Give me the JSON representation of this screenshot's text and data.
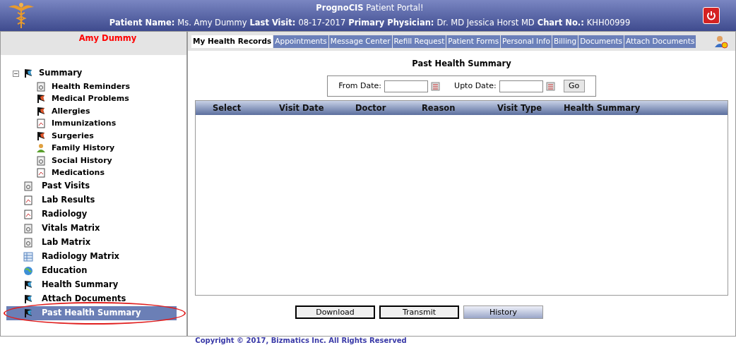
{
  "header": {
    "title": "**PrognoCIS** Patient Portal!",
    "fields": [
      {
        "label": "Patient Name:",
        "value": "Ms. Amy Dummy"
      },
      {
        "label": "Last Visit:",
        "value": "08-17-2017"
      },
      {
        "label": "Primary Physician:",
        "value": "Dr. MD Jessica Horst MD"
      },
      {
        "label": "Chart No.:",
        "value": "KHH00999"
      }
    ]
  },
  "sidebar": {
    "patient_name": "Amy Dummy",
    "items": [
      {
        "label": "Summary",
        "selected": false,
        "expanded": true,
        "children": [
          {
            "label": "Health Reminders",
            "selected": false
          },
          {
            "label": "Medical Problems",
            "selected": false
          },
          {
            "label": "Allergies",
            "selected": false
          },
          {
            "label": "Immunizations",
            "selected": false
          },
          {
            "label": "Surgeries",
            "selected": false
          },
          {
            "label": "Family History",
            "selected": false
          },
          {
            "label": "Social History",
            "selected": false
          },
          {
            "label": "Medications",
            "selected": false
          }
        ]
      },
      {
        "label": "Past Visits",
        "selected": false
      },
      {
        "label": "Lab Results",
        "selected": false
      },
      {
        "label": "Radiology",
        "selected": false
      },
      {
        "label": "Vitals Matrix",
        "selected": false
      },
      {
        "label": "Lab Matrix",
        "selected": false
      },
      {
        "label": "Radiology Matrix",
        "selected": false
      },
      {
        "label": "Education",
        "selected": false
      },
      {
        "label": "Health Summary",
        "selected": false
      },
      {
        "label": "Attach Documents",
        "selected": false
      },
      {
        "label": "Past Health Summary",
        "selected": true
      }
    ]
  },
  "tabs": [
    {
      "label": "My Health Records",
      "selected": true
    },
    {
      "label": "Appointments",
      "selected": false
    },
    {
      "label": "Message Center",
      "selected": false
    },
    {
      "label": "Refill Request",
      "selected": false
    },
    {
      "label": "Patient Forms",
      "selected": false
    },
    {
      "label": "Personal Info",
      "selected": false
    },
    {
      "label": "Billing",
      "selected": false
    },
    {
      "label": "Documents",
      "selected": false
    },
    {
      "label": "Attach Documents",
      "selected": false
    }
  ],
  "content": {
    "title": "Past Health Summary",
    "filters": [
      {
        "label": "From Date:"
      },
      {
        "label": "Upto Date:"
      }
    ],
    "go_button": "Go",
    "table": {
      "columns": [
        "Select",
        "Visit Date",
        "Doctor",
        "Reason",
        "Visit Type",
        "Health Summary"
      ]
    },
    "buttons": [
      {
        "label": "Download",
        "kind": "bordered"
      },
      {
        "label": "Transmit",
        "kind": "bordered"
      },
      {
        "label": "History",
        "kind": "raised"
      }
    ]
  },
  "footer": "Copyright © 2017, Bizmatics Inc. All Rights Reserved"
}
